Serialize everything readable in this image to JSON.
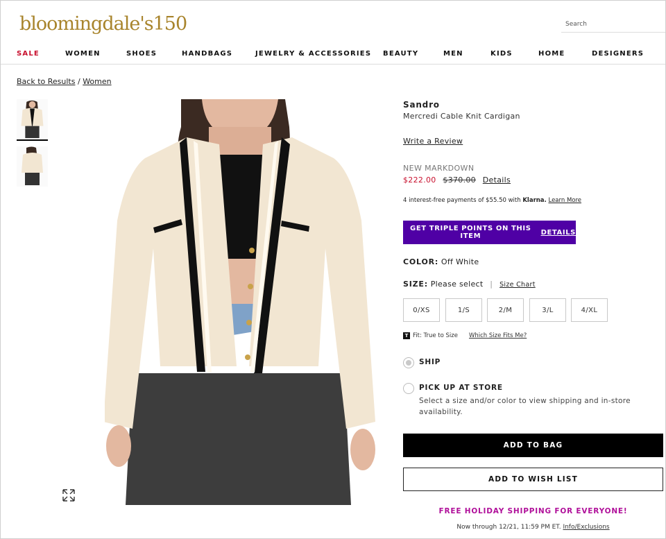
{
  "header": {
    "logo_text": "bloomingdale's150",
    "search_placeholder": "Search",
    "nav": [
      "SALE",
      "WOMEN",
      "SHOES",
      "HANDBAGS",
      "JEWELRY & ACCESSORIES",
      "BEAUTY",
      "MEN",
      "KIDS",
      "HOME",
      "DESIGNERS"
    ],
    "sale_color": "#c8102e"
  },
  "breadcrumb": {
    "back": "Back to Results",
    "separator": "/",
    "category": "Women"
  },
  "gallery": {
    "thumbnails": [
      "front-view",
      "side-view"
    ],
    "active_index": 0,
    "expand_icon": "expand-icon"
  },
  "product": {
    "brand": "Sandro",
    "name": "Mercredi Cable Knit Cardigan",
    "review_link": "Write a Review",
    "markdown_label": "NEW MARKDOWN",
    "sale_price": "$222.00",
    "original_price": "$370.00",
    "details_link": "Details",
    "klarna": {
      "prefix": "4 interest-free payments of $55.50 with",
      "brand": "Klarna.",
      "link": "Learn More"
    },
    "points_banner": {
      "text": "GET TRIPLE POINTS ON THIS ITEM",
      "link": "DETAILS",
      "color": "#4f00a5"
    },
    "color": {
      "label": "COLOR:",
      "value": "Off White"
    },
    "size": {
      "label": "SIZE:",
      "value": "Please select",
      "chart_link": "Size Chart",
      "options": [
        "0/XS",
        "1/S",
        "2/M",
        "3/L",
        "4/XL"
      ]
    },
    "fit": {
      "icon_letter": "T",
      "text": "Fit: True to Size",
      "link": "Which Size Fits Me?"
    },
    "fulfillment": {
      "ship_label": "SHIP",
      "pickup_label": "PICK UP AT STORE",
      "pickup_note": "Select a size and/or color to view shipping and in-store availability.",
      "selected": "ship"
    },
    "add_to_bag": "ADD TO BAG",
    "add_to_wishlist": "ADD TO WISH LIST"
  },
  "promo": {
    "headline": "FREE HOLIDAY SHIPPING FOR EVERYONE!",
    "subtext": "Now through 12/21, 11:59 PM ET.",
    "link": "Info/Exclusions",
    "color": "#b0109a"
  }
}
